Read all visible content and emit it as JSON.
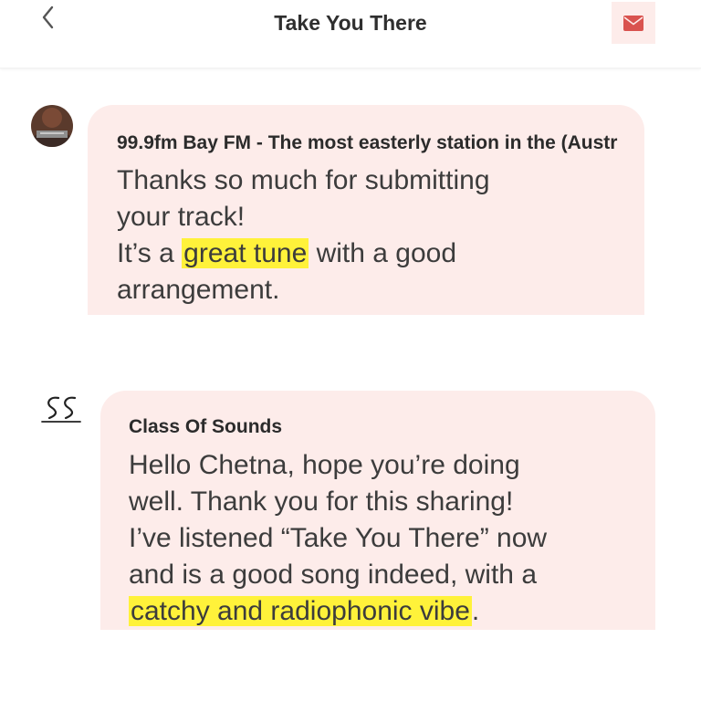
{
  "header": {
    "title": "Take You There",
    "back_icon": "chevron-left-icon",
    "mail_icon": "envelope-icon",
    "accent_color": "#d9534f"
  },
  "messages": [
    {
      "sender": "99.9fm Bay FM - The most easterly station in the (Austr",
      "avatar": "station-photo-avatar",
      "lines": [
        {
          "pre": "Thanks so much for submitting",
          "hl": "",
          "post": ""
        },
        {
          "pre": "your track!",
          "hl": "",
          "post": ""
        },
        {
          "pre": "It’s a ",
          "hl": "great tune",
          "post": " with a good"
        },
        {
          "pre": "arrangement.",
          "hl": "",
          "post": ""
        }
      ]
    },
    {
      "sender": "Class Of Sounds",
      "avatar": "class-of-sounds-logo",
      "lines": [
        {
          "pre": "Hello Chetna, hope you’re doing",
          "hl": "",
          "post": ""
        },
        {
          "pre": "well. Thank you for this sharing!",
          "hl": "",
          "post": ""
        },
        {
          "pre": "I’ve listened “Take You There” now",
          "hl": "",
          "post": ""
        },
        {
          "pre": "and is a good song indeed, with a",
          "hl": "",
          "post": ""
        },
        {
          "pre": "",
          "hl": "catchy and radiophonic vibe",
          "post": "."
        }
      ]
    }
  ],
  "colors": {
    "bubble_bg": "#fdecea",
    "highlight": "#fff23a"
  }
}
